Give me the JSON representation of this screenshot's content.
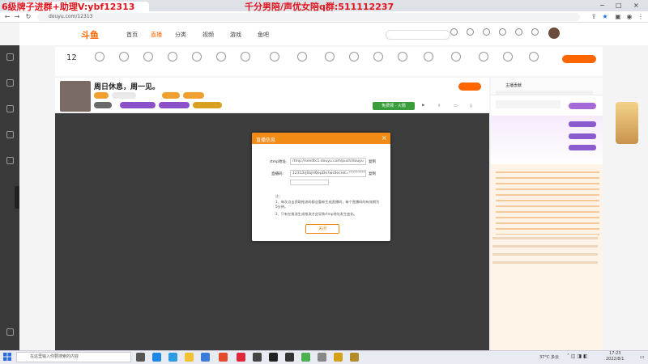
{
  "browser": {
    "tab_title": "",
    "url": "douyu.com/12313",
    "overlay_left": "6级牌子进群+助理V:ybf12313",
    "overlay_right": "千分男陪/声优女陪q群:511112237"
  },
  "nav": {
    "logo": "斗鱼",
    "items": [
      "首页",
      "直播",
      "分类",
      "视频",
      "游戏",
      "鱼吧"
    ],
    "search_placeholder": ""
  },
  "tools": {
    "level": "12"
  },
  "room": {
    "title": "周日休息，周一见。",
    "category": "",
    "follow_count": "",
    "follow_label": "",
    "green_btn": "免费领 · 火箭",
    "hint": ""
  },
  "modal": {
    "title": "直播信息",
    "rtmp_label": "rtmp地址:",
    "rtmp_value": "rtmp://sendtc1.douyu.com/push/douyu",
    "copy": "复制",
    "code_label": "直播码:",
    "code_value": "12313rjEbjHQepDe?wsSecret=**********",
    "select_value": "",
    "warn": "",
    "link": "",
    "notes_title": "注：",
    "notes": [
      "1、每次点击获取推流码都会重新生成直播码，每个直播码的有效期为5分钟。",
      "2、只有在推流生成推流才会导致rtmp地址发生变化。"
    ],
    "ok": "关闭"
  },
  "right": {
    "tab1": "主播贡献",
    "tab2": "",
    "rank_btn": "",
    "banner_title": "",
    "row1": "",
    "row2": ""
  },
  "gift": {
    "label": ""
  },
  "taskbar": {
    "search": "在这里输入你要搜索的内容",
    "temp": "37°C 多云",
    "time": "17:23",
    "date": "2022/8/1"
  }
}
